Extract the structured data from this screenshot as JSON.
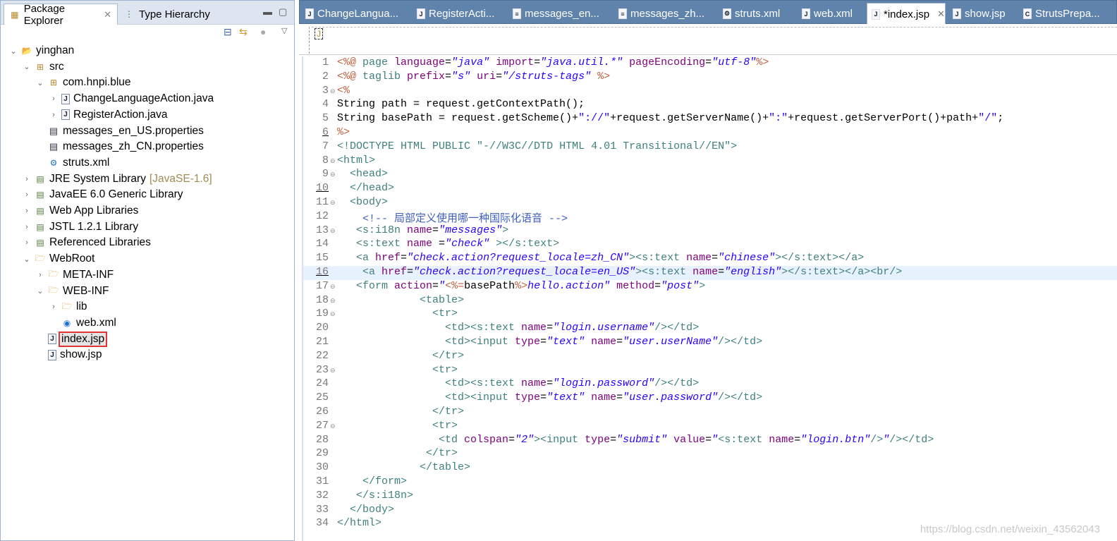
{
  "left_panel": {
    "tabs": [
      {
        "label": "Package Explorer",
        "active": true
      },
      {
        "label": "Type Hierarchy",
        "active": false
      }
    ],
    "tree": [
      {
        "label": "yinghan",
        "depth": 0,
        "chevron": "open",
        "icon": "project"
      },
      {
        "label": "src",
        "depth": 1,
        "chevron": "open",
        "icon": "pkg"
      },
      {
        "label": "com.hnpi.blue",
        "depth": 2,
        "chevron": "open",
        "icon": "pkg"
      },
      {
        "label": "ChangeLanguageAction.java",
        "depth": 3,
        "chevron": "closed",
        "icon": "java"
      },
      {
        "label": "RegisterAction.java",
        "depth": 3,
        "chevron": "closed",
        "icon": "java"
      },
      {
        "label": "messages_en_US.properties",
        "depth": 2,
        "chevron": "none",
        "icon": "props"
      },
      {
        "label": "messages_zh_CN.properties",
        "depth": 2,
        "chevron": "none",
        "icon": "props"
      },
      {
        "label": "struts.xml",
        "depth": 2,
        "chevron": "none",
        "icon": "gear"
      },
      {
        "label": "JRE System Library",
        "decoration": "[JavaSE-1.6]",
        "depth": 1,
        "chevron": "closed",
        "icon": "lib"
      },
      {
        "label": "JavaEE 6.0 Generic Library",
        "depth": 1,
        "chevron": "closed",
        "icon": "lib"
      },
      {
        "label": "Web App Libraries",
        "depth": 1,
        "chevron": "closed",
        "icon": "lib"
      },
      {
        "label": "JSTL 1.2.1 Library",
        "depth": 1,
        "chevron": "closed",
        "icon": "lib"
      },
      {
        "label": "Referenced Libraries",
        "depth": 1,
        "chevron": "closed",
        "icon": "lib"
      },
      {
        "label": "WebRoot",
        "depth": 1,
        "chevron": "open",
        "icon": "folder"
      },
      {
        "label": "META-INF",
        "depth": 2,
        "chevron": "closed",
        "icon": "folder"
      },
      {
        "label": "WEB-INF",
        "depth": 2,
        "chevron": "open",
        "icon": "folder"
      },
      {
        "label": "lib",
        "depth": 3,
        "chevron": "closed",
        "icon": "folder"
      },
      {
        "label": "web.xml",
        "depth": 3,
        "chevron": "none",
        "icon": "xml"
      },
      {
        "label": "index.jsp",
        "depth": 2,
        "chevron": "none",
        "icon": "jsp",
        "selected": true
      },
      {
        "label": "show.jsp",
        "depth": 2,
        "chevron": "none",
        "icon": "jsp"
      }
    ]
  },
  "editor": {
    "tabs": [
      {
        "label": "ChangeLangua...",
        "icon": "java"
      },
      {
        "label": "RegisterActi...",
        "icon": "java"
      },
      {
        "label": "messages_en...",
        "icon": "props"
      },
      {
        "label": "messages_zh...",
        "icon": "props"
      },
      {
        "label": "struts.xml",
        "icon": "gear"
      },
      {
        "label": "web.xml",
        "icon": "xml"
      },
      {
        "label": "*index.jsp",
        "icon": "jsp",
        "active": true
      },
      {
        "label": "show.jsp",
        "icon": "jsp"
      },
      {
        "label": "StrutsPrepa...",
        "icon": "class"
      }
    ],
    "current_line": 16,
    "lines": [
      [
        [
          "delim",
          "<%@"
        ],
        [
          "tag",
          " page "
        ],
        [
          "attr",
          "language"
        ],
        [
          "java",
          "="
        ],
        [
          "val",
          "\"java\""
        ],
        [
          "attr",
          " import"
        ],
        [
          "java",
          "="
        ],
        [
          "val",
          "\"java.util.*\""
        ],
        [
          "attr",
          " pageEncoding"
        ],
        [
          "java",
          "="
        ],
        [
          "val",
          "\"utf-8\""
        ],
        [
          "delim",
          "%>"
        ]
      ],
      [
        [
          "delim",
          "<%@"
        ],
        [
          "tag",
          " taglib "
        ],
        [
          "attr",
          "prefix"
        ],
        [
          "java",
          "="
        ],
        [
          "val",
          "\"s\""
        ],
        [
          "attr",
          " uri"
        ],
        [
          "java",
          "="
        ],
        [
          "val",
          "\"/struts-tags\""
        ],
        [
          "delim",
          " %>"
        ]
      ],
      [
        [
          "delim",
          "<%"
        ]
      ],
      [
        [
          "java",
          "String path = request.getContextPath();"
        ]
      ],
      [
        [
          "java",
          "String basePath = request.getScheme()+"
        ],
        [
          "str",
          "\"://\""
        ],
        [
          "java",
          "+request.getServerName()+"
        ],
        [
          "str",
          "\":\""
        ],
        [
          "java",
          "+request.getServerPort()+path+"
        ],
        [
          "str",
          "\"/\""
        ],
        [
          "java",
          ";"
        ]
      ],
      [
        [
          "delim",
          "%>"
        ]
      ],
      [
        [
          "tag",
          "<!DOCTYPE HTML PUBLIC "
        ],
        [
          "docstr",
          "\"-//W3C//DTD HTML 4.01 Transitional//EN\""
        ],
        [
          "tag",
          ">"
        ]
      ],
      [
        [
          "tag",
          "<html>"
        ]
      ],
      [
        [
          "tag",
          "  <head>"
        ]
      ],
      [
        [
          "tag",
          "  </head>"
        ]
      ],
      [
        [
          "tag",
          "  <body>"
        ]
      ],
      [
        [
          "com",
          "    <!-- 局部定义使用哪一种国际化语音 -->"
        ]
      ],
      [
        [
          "tag",
          "   <s:i18n "
        ],
        [
          "attr",
          "name"
        ],
        [
          "java",
          "="
        ],
        [
          "val",
          "\"messages\""
        ],
        [
          "tag",
          ">"
        ]
      ],
      [
        [
          "tag",
          "   <s:text "
        ],
        [
          "attr",
          "name "
        ],
        [
          "java",
          "="
        ],
        [
          "val",
          "\"check\""
        ],
        [
          "tag",
          " ></s:text>"
        ]
      ],
      [
        [
          "tag",
          "   <a "
        ],
        [
          "attr",
          "href"
        ],
        [
          "java",
          "="
        ],
        [
          "val",
          "\"check.action?request_locale=zh_CN\""
        ],
        [
          "tag",
          "><s:text "
        ],
        [
          "attr",
          "name"
        ],
        [
          "java",
          "="
        ],
        [
          "val",
          "\"chinese\""
        ],
        [
          "tag",
          "></s:text></a>"
        ]
      ],
      [
        [
          "tag",
          "    <a "
        ],
        [
          "attr",
          "href"
        ],
        [
          "java",
          "="
        ],
        [
          "val",
          "\"check.action?request_locale=en_US\""
        ],
        [
          "tag",
          "><s:text "
        ],
        [
          "attr",
          "name"
        ],
        [
          "java",
          "="
        ],
        [
          "val",
          "\"english\""
        ],
        [
          "tag",
          "></s:text></a><br/>"
        ]
      ],
      [
        [
          "tag",
          "   <form "
        ],
        [
          "attr",
          "action"
        ],
        [
          "java",
          "="
        ],
        [
          "val",
          "\""
        ],
        [
          "delim",
          "<%="
        ],
        [
          "java",
          "basePath"
        ],
        [
          "delim",
          "%>"
        ],
        [
          "val",
          "hello.action\""
        ],
        [
          "attr",
          " method"
        ],
        [
          "java",
          "="
        ],
        [
          "val",
          "\"post\""
        ],
        [
          "tag",
          ">"
        ]
      ],
      [
        [
          "tag",
          "             <table>"
        ]
      ],
      [
        [
          "tag",
          "               <tr>"
        ]
      ],
      [
        [
          "tag",
          "                 <td><s:text "
        ],
        [
          "attr",
          "name"
        ],
        [
          "java",
          "="
        ],
        [
          "val",
          "\"login.username\""
        ],
        [
          "tag",
          "/></td>"
        ]
      ],
      [
        [
          "tag",
          "                 <td><input "
        ],
        [
          "attr",
          "type"
        ],
        [
          "java",
          "="
        ],
        [
          "val",
          "\"text\""
        ],
        [
          "attr",
          " name"
        ],
        [
          "java",
          "="
        ],
        [
          "val",
          "\"user.userName\""
        ],
        [
          "tag",
          "/></td>"
        ]
      ],
      [
        [
          "tag",
          "               </tr>"
        ]
      ],
      [
        [
          "tag",
          "               <tr>"
        ]
      ],
      [
        [
          "tag",
          "                 <td><s:text "
        ],
        [
          "attr",
          "name"
        ],
        [
          "java",
          "="
        ],
        [
          "val",
          "\"login.password\""
        ],
        [
          "tag",
          "/></td>"
        ]
      ],
      [
        [
          "tag",
          "                 <td><input "
        ],
        [
          "attr",
          "type"
        ],
        [
          "java",
          "="
        ],
        [
          "val",
          "\"text\""
        ],
        [
          "attr",
          " name"
        ],
        [
          "java",
          "="
        ],
        [
          "val",
          "\"user.password\""
        ],
        [
          "tag",
          "/></td>"
        ]
      ],
      [
        [
          "tag",
          "               </tr>"
        ]
      ],
      [
        [
          "tag",
          "               <tr>"
        ]
      ],
      [
        [
          "tag",
          "                <td "
        ],
        [
          "attr",
          "colspan"
        ],
        [
          "java",
          "="
        ],
        [
          "val",
          "\"2\""
        ],
        [
          "tag",
          "><input "
        ],
        [
          "attr",
          "type"
        ],
        [
          "java",
          "="
        ],
        [
          "val",
          "\"submit\""
        ],
        [
          "attr",
          " value"
        ],
        [
          "java",
          "="
        ],
        [
          "val",
          "\""
        ],
        [
          "tag",
          "<s:text "
        ],
        [
          "attr",
          "name"
        ],
        [
          "java",
          "="
        ],
        [
          "val",
          "\"login.btn\""
        ],
        [
          "tag",
          "/>"
        ],
        [
          "val",
          "\""
        ],
        [
          "tag",
          "/></td>"
        ]
      ],
      [
        [
          "tag",
          "              </tr>"
        ]
      ],
      [
        [
          "tag",
          "             </table>"
        ]
      ],
      [
        [
          "tag",
          "    </form>"
        ]
      ],
      [
        [
          "tag",
          "   </s:i18n>"
        ]
      ],
      [
        [
          "tag",
          "  </body>"
        ]
      ],
      [
        [
          "tag",
          "</html>"
        ]
      ]
    ],
    "fold_lines": [
      3,
      8,
      9,
      11,
      13,
      17,
      18,
      19,
      23,
      27
    ],
    "marked_lines": [
      6,
      10,
      16
    ]
  },
  "watermark": "https://blog.csdn.net/weixin_43562043"
}
